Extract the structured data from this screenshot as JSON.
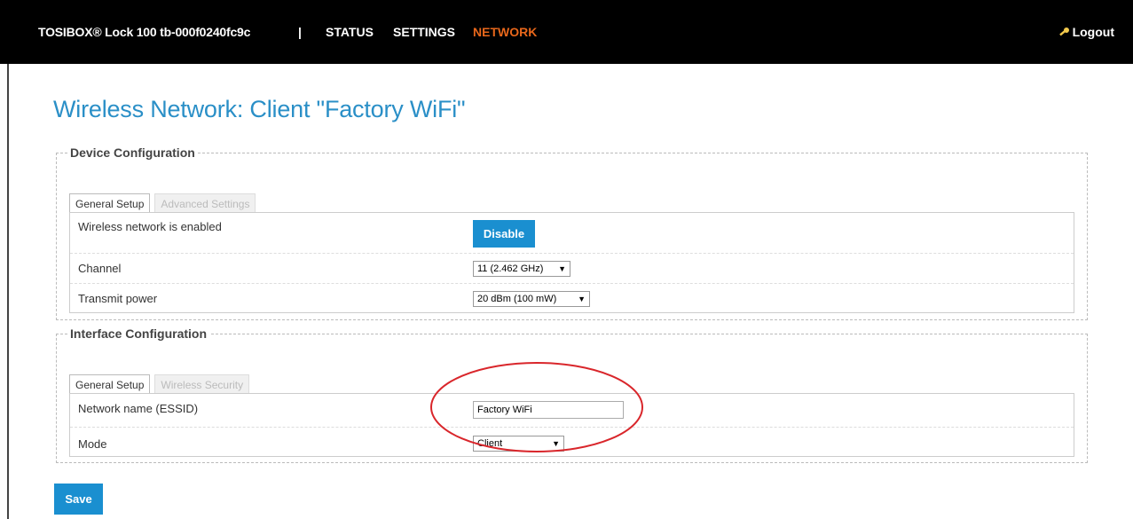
{
  "header": {
    "brand": "TOSIBOX® Lock 100 tb-000f0240fc9c",
    "separator": "|",
    "nav": [
      "STATUS",
      "SETTINGS",
      "NETWORK"
    ],
    "active_nav": "NETWORK",
    "logout": "Logout"
  },
  "page": {
    "title": "Wireless Network: Client \"Factory WiFi\""
  },
  "device_config": {
    "legend": "Device Configuration",
    "tabs": [
      "General Setup",
      "Advanced Settings"
    ],
    "rows": [
      {
        "label": "Wireless network is enabled",
        "button": "Disable"
      },
      {
        "label": "Channel",
        "value": "11 (2.462 GHz)"
      },
      {
        "label": "Transmit power",
        "value": "20 dBm (100 mW)"
      }
    ]
  },
  "interface_config": {
    "legend": "Interface Configuration",
    "tabs": [
      "General Setup",
      "Wireless Security"
    ],
    "rows": [
      {
        "label": "Network name (ESSID)",
        "value": "Factory WiFi"
      },
      {
        "label": "Mode",
        "value": "Client"
      }
    ]
  },
  "footer": {
    "save": "Save"
  },
  "colors": {
    "accent": "#1a8fd0",
    "title": "#2a8fc7",
    "active_nav": "#e8671b",
    "annotation": "#d9262b"
  }
}
